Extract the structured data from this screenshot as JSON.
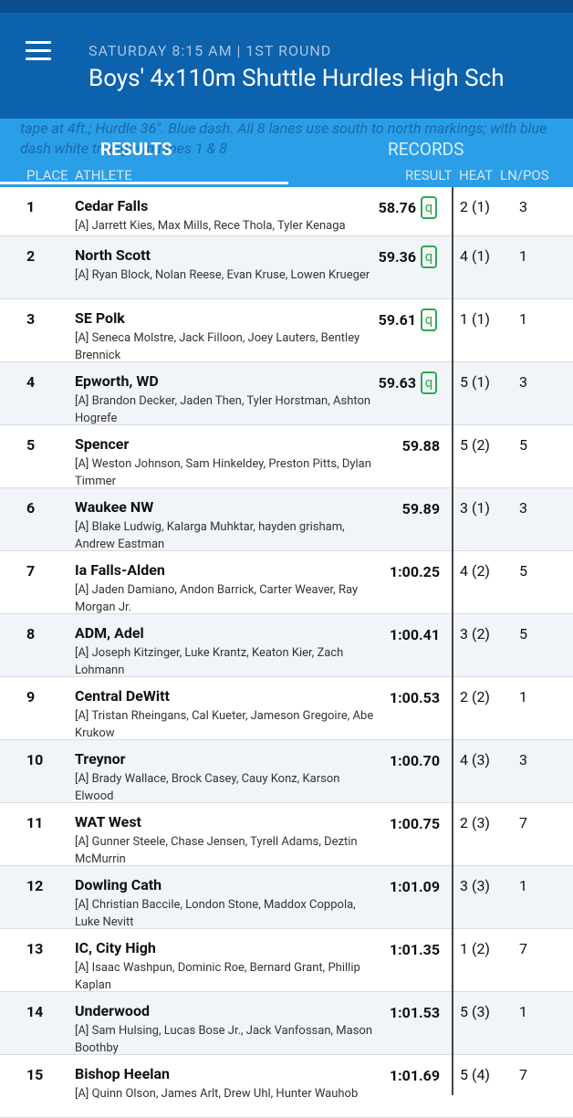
{
  "header": {
    "subtitle": "SATURDAY 8:15 AM | 1ST ROUND",
    "title": "Boys' 4x110m Shuttle Hurdles High Sch"
  },
  "note": "tape at 4ft.; Hurdle 36\". Blue dash. All 8 lanes use south to north markings; with blue dash white triangle in lanes 1 & 8",
  "tabs": {
    "results": "RESULTS",
    "records": "RECORDS"
  },
  "columns": {
    "place": "PLACE",
    "athlete": "ATHLETE",
    "result": "RESULT",
    "heat": "HEAT",
    "lane": "LN/POS"
  },
  "qualifier_label": "q",
  "rows": [
    {
      "place": "1",
      "team": "Cedar Falls",
      "athletes": "[A] Jarrett Kies, Max Mills, Rece Thola, Tyler Kenaga",
      "result": "58.76",
      "q": true,
      "heat": "2 (1)",
      "lane": "3"
    },
    {
      "place": "2",
      "team": "North Scott",
      "athletes": "[A] Ryan Block, Nolan Reese, Evan Kruse, Lowen Krueger",
      "result": "59.36",
      "q": true,
      "heat": "4 (1)",
      "lane": "1"
    },
    {
      "place": "3",
      "team": "SE Polk",
      "athletes": "[A] Seneca Molstre, Jack Filloon, Joey Lauters, Bentley Brennick",
      "result": "59.61",
      "q": true,
      "heat": "1 (1)",
      "lane": "1"
    },
    {
      "place": "4",
      "team": "Epworth, WD",
      "athletes": "[A] Brandon Decker, Jaden Then, Tyler Horstman, Ashton Hogrefe",
      "result": "59.63",
      "q": true,
      "heat": "5 (1)",
      "lane": "3"
    },
    {
      "place": "5",
      "team": "Spencer",
      "athletes": "[A] Weston Johnson, Sam Hinkeldey, Preston Pitts, Dylan Timmer",
      "result": "59.88",
      "q": false,
      "heat": "5 (2)",
      "lane": "5"
    },
    {
      "place": "6",
      "team": "Waukee NW",
      "athletes": "[A] Blake Ludwig, Kalarga Muhktar, hayden grisham, Andrew Eastman",
      "result": "59.89",
      "q": false,
      "heat": "3 (1)",
      "lane": "3"
    },
    {
      "place": "7",
      "team": "Ia Falls-Alden",
      "athletes": "[A] Jaden Damiano, Andon Barrick, Carter Weaver, Ray Morgan Jr.",
      "result": "1:00.25",
      "q": false,
      "heat": "4 (2)",
      "lane": "5"
    },
    {
      "place": "8",
      "team": "ADM, Adel",
      "athletes": "[A] Joseph Kitzinger, Luke Krantz, Keaton Kier, Zach Lohmann",
      "result": "1:00.41",
      "q": false,
      "heat": "3 (2)",
      "lane": "5"
    },
    {
      "place": "9",
      "team": "Central DeWitt",
      "athletes": "[A] Tristan Rheingans, Cal Kueter, Jameson Gregoire, Abe Krukow",
      "result": "1:00.53",
      "q": false,
      "heat": "2 (2)",
      "lane": "1"
    },
    {
      "place": "10",
      "team": "Treynor",
      "athletes": "[A] Brady Wallace, Brock Casey, Cauy Konz, Karson Elwood",
      "result": "1:00.70",
      "q": false,
      "heat": "4 (3)",
      "lane": "3"
    },
    {
      "place": "11",
      "team": "WAT West",
      "athletes": "[A] Gunner Steele, Chase Jensen, Tyrell Adams, Deztin McMurrin",
      "result": "1:00.75",
      "q": false,
      "heat": "2 (3)",
      "lane": "7"
    },
    {
      "place": "12",
      "team": "Dowling Cath",
      "athletes": "[A] Christian Baccile, London Stone, Maddox Coppola, Luke Nevitt",
      "result": "1:01.09",
      "q": false,
      "heat": "3 (3)",
      "lane": "1"
    },
    {
      "place": "13",
      "team": "IC, City High",
      "athletes": "[A] Isaac Washpun, Dominic Roe, Bernard Grant, Phillip Kaplan",
      "result": "1:01.35",
      "q": false,
      "heat": "1 (2)",
      "lane": "7"
    },
    {
      "place": "14",
      "team": "Underwood",
      "athletes": "[A] Sam Hulsing, Lucas Bose Jr., Jack Vanfossan, Mason Boothby",
      "result": "1:01.53",
      "q": false,
      "heat": "5 (3)",
      "lane": "1"
    },
    {
      "place": "15",
      "team": "Bishop Heelan",
      "athletes": "[A] Quinn Olson, James Arlt, Drew Uhl, Hunter Wauhob",
      "result": "1:01.69",
      "q": false,
      "heat": "5 (4)",
      "lane": "7"
    }
  ]
}
